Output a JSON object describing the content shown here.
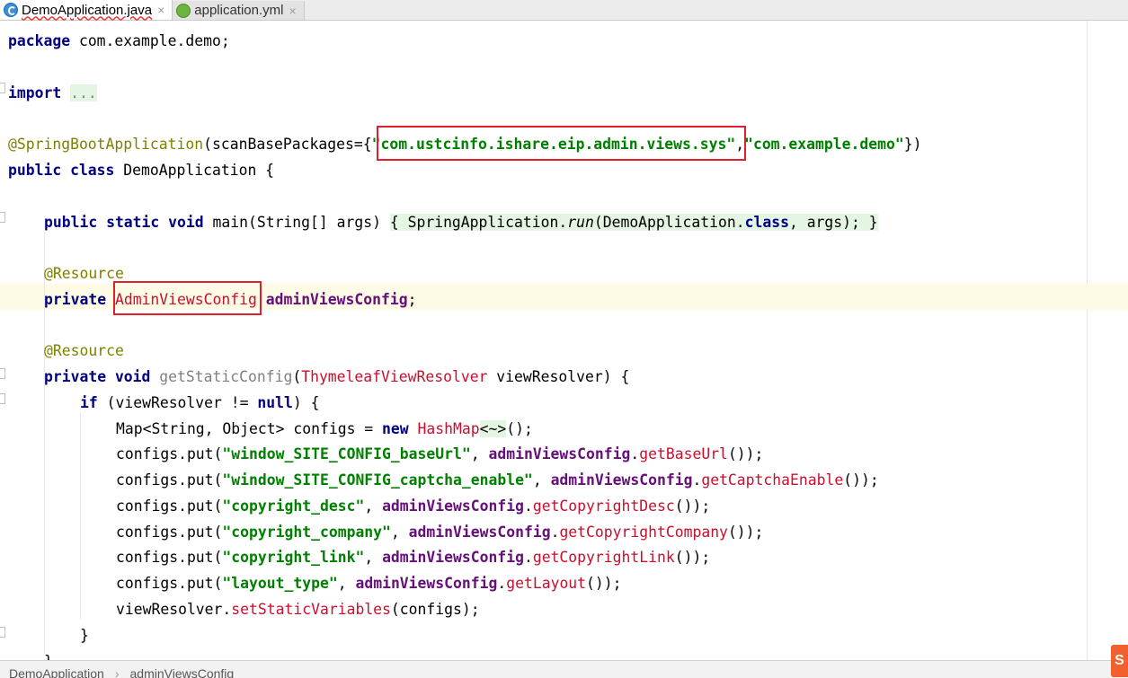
{
  "tabs": [
    {
      "label": "DemoApplication.java",
      "icon": "java-class-icon",
      "active": true,
      "close": "×"
    },
    {
      "label": "application.yml",
      "icon": "spring-yml-icon",
      "active": false,
      "close": "×"
    }
  ],
  "code": {
    "package_kw": "package",
    "package_name": " com.example.demo;",
    "import_kw": "import",
    "import_fold": "...",
    "annotation": "@SpringBootApplication",
    "scan_open": "(scanBasePackages={",
    "scan_pkg1": "\"com.ustcinfo.ishare.eip.admin.views.sys\"",
    "scan_comma": ",",
    "scan_pkg2": "\"com.example.demo\"",
    "scan_close": "})",
    "class_kw": "public class",
    "class_name": " DemoApplication {",
    "main_kw": "public static void",
    "main_sig": " main(String[] args) ",
    "main_body_open": "{ SpringApplication.",
    "main_run": "run",
    "main_args": "(DemoApplication.",
    "main_class_kw": "class",
    "main_tail": ", args); }",
    "resource1": "@Resource",
    "private_kw": "private",
    "field_type": "AdminViewsConfig",
    "field_name": "adminViewsConfig",
    "field_end": ";",
    "resource2": "@Resource",
    "method_kw": "private void",
    "method_name": "getStaticConfig",
    "method_param_type": "ThymeleafViewResolver",
    "method_param": " viewResolver) {",
    "if_kw": "if",
    "if_cond": " (viewResolver != ",
    "null_kw": "null",
    "if_tail": ") {",
    "map_decl": "Map<String, Object> configs = ",
    "new_kw": "new",
    "hashmap": "HashMap",
    "diamond": "<~>",
    "map_tail": "();",
    "puts": [
      {
        "key": "\"window_SITE_CONFIG_baseUrl\"",
        "getter": "getBaseUrl"
      },
      {
        "key": "\"window_SITE_CONFIG_captcha_enable\"",
        "getter": "getCaptchaEnable"
      },
      {
        "key": "\"copyright_desc\"",
        "getter": "getCopyrightDesc"
      },
      {
        "key": "\"copyright_company\"",
        "getter": "getCopyrightCompany"
      },
      {
        "key": "\"copyright_link\"",
        "getter": "getCopyrightLink"
      },
      {
        "key": "\"layout_type\"",
        "getter": "getLayout"
      }
    ],
    "put_prefix": "configs.put(",
    "put_mid": ", ",
    "put_obj": "adminViewsConfig",
    "put_dot": ".",
    "put_tail": "());",
    "set_prefix": "viewResolver.",
    "set_method": "setStaticVariables",
    "set_tail": "(configs);",
    "close_brace_if": "}",
    "close_brace_method": "}"
  },
  "breadcrumb": [
    "DemoApplication",
    "adminViewsConfig"
  ],
  "breadcrumb_sep": "›",
  "ime_badge": "S"
}
